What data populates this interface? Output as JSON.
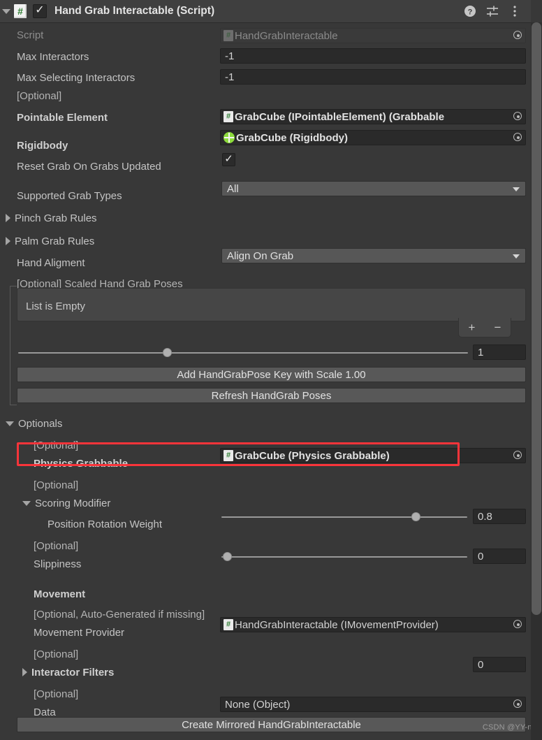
{
  "header": {
    "title": "Hand Grab Interactable (Script)",
    "enabled_checkbox": true,
    "script_icon": "csharp-script-icon",
    "foldout": "expanded",
    "icons": {
      "help": "help-icon",
      "preset": "preset-settings-icon",
      "menu": "more-options-icon"
    }
  },
  "fields": {
    "script": {
      "label": "Script",
      "value": "HandGrabInteractable",
      "disabled": true
    },
    "max_interactors": {
      "label": "Max Interactors",
      "value": "-1"
    },
    "max_selecting_interactors": {
      "label": "Max Selecting Interactors",
      "value": "-1"
    },
    "optional_tag_1": "[Optional]",
    "pointable_element": {
      "label": "Pointable Element",
      "value": "GrabCube (IPointableElement) (Grabbable"
    },
    "rigidbody": {
      "label": "Rigidbody",
      "value": "GrabCube (Rigidbody)"
    },
    "reset_grab": {
      "label": "Reset Grab On Grabs Updated",
      "checked": true
    },
    "supported_grab_types": {
      "label": "Supported Grab Types",
      "value": "All"
    },
    "pinch_grab_rules": {
      "label": "Pinch Grab Rules",
      "foldout": "collapsed"
    },
    "palm_grab_rules": {
      "label": "Palm Grab Rules",
      "foldout": "collapsed"
    },
    "hand_aligment": {
      "label": "Hand Aligment",
      "value": "Align On Grab"
    },
    "scaled_poses_header": "[Optional] Scaled Hand Grab Poses",
    "list_empty": "List is Empty",
    "list_add": "+",
    "list_remove": "−",
    "scale_value": "1",
    "add_pose_button": "Add HandGrabPose Key with Scale 1.00",
    "refresh_poses_button": "Refresh HandGrab Poses"
  },
  "optionals": {
    "section_label": "Optionals",
    "foldout": "expanded",
    "optional_tag_2": "[Optional]",
    "physics_grabbable": {
      "label": "Physics Grabbable",
      "value": "GrabCube (Physics Grabbable)",
      "highlighted": true
    },
    "optional_tag_3": "[Optional]",
    "scoring_modifier": {
      "label": "Scoring Modifier",
      "foldout": "expanded"
    },
    "position_rotation_weight": {
      "label": "Position Rotation Weight",
      "value": "0.8",
      "slider_pct": 79
    },
    "optional_tag_4": "[Optional]",
    "slippiness": {
      "label": "Slippiness",
      "value": "0",
      "slider_pct": 2
    },
    "movement_header": "Movement",
    "optional_tag_5": "[Optional, Auto-Generated if missing]",
    "movement_provider": {
      "label": "Movement Provider",
      "value": "HandGrabInteractable (IMovementProvider)"
    },
    "optional_tag_6": "[Optional]",
    "interactor_filters": {
      "label": "Interactor Filters",
      "value": "0",
      "foldout": "collapsed"
    },
    "optional_tag_7": "[Optional]",
    "data": {
      "label": "Data",
      "value": "None (Object)"
    },
    "create_mirrored_button": "Create Mirrored HandGrabInteractable"
  },
  "watermark": "CSDN @YY-nb",
  "colors": {
    "background": "#383838",
    "header": "#3f3f3f",
    "field_bg": "#2a2a2a",
    "dropdown_bg": "#575757",
    "button_bg": "#585858",
    "highlight": "#f9343a",
    "text": "#c4c4c4",
    "script_green": "#2e7d32",
    "rigidbody_green": "#8ddb3c"
  }
}
